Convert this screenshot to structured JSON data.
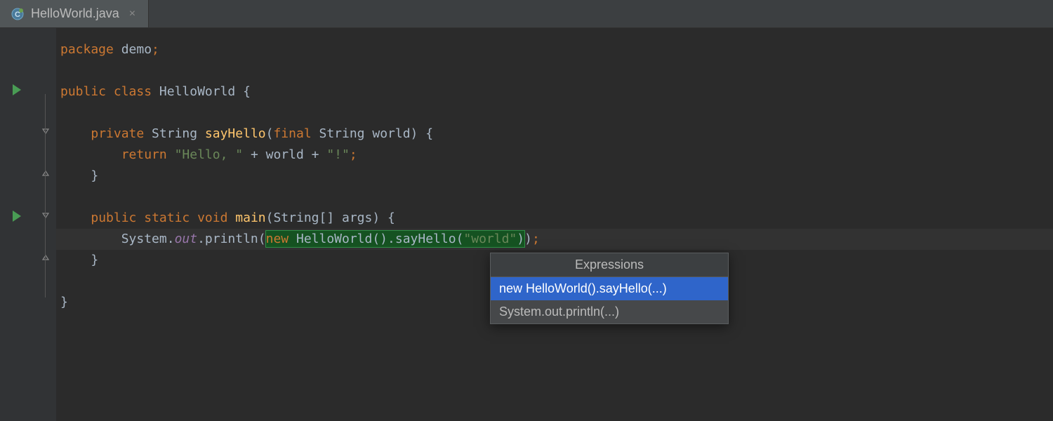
{
  "tab": {
    "filename": "HelloWorld.java"
  },
  "code": {
    "package_kw": "package",
    "package_name": " demo",
    "semicolon": ";",
    "public_kw": "public",
    "class_kw": " class",
    "class_name": " HelloWorld ",
    "lbrace": "{",
    "private_kw": "private",
    "ret_type": " String ",
    "method1": "sayHello",
    "m1_open": "(",
    "final_kw": "final",
    "m1_param_type": " String ",
    "m1_param_name": "world",
    "m1_close": ") ",
    "return_kw": "return",
    "str_hello": " \"Hello, \"",
    "plus1": " + ",
    "world_id": "world",
    "plus2": " + ",
    "str_bang": "\"!\"",
    "rbrace_m1": "}",
    "static_kw": " static",
    "void_kw": " void",
    "main": " main",
    "main_open": "(",
    "main_param": "String[] args",
    "main_close": ") ",
    "sys": "System.",
    "out": "out",
    "dot_println": ".println(",
    "new_kw": "new",
    "hw_ctor": " HelloWorld().",
    "say_call": "sayHello",
    "say_open": "(",
    "str_world": "\"world\"",
    "say_close": ")",
    "println_close": ")",
    "rbrace_main": "}",
    "rbrace_class": "}"
  },
  "popup": {
    "title": "Expressions",
    "items": [
      "new HelloWorld().sayHello(...)",
      "System.out.println(...)"
    ]
  }
}
